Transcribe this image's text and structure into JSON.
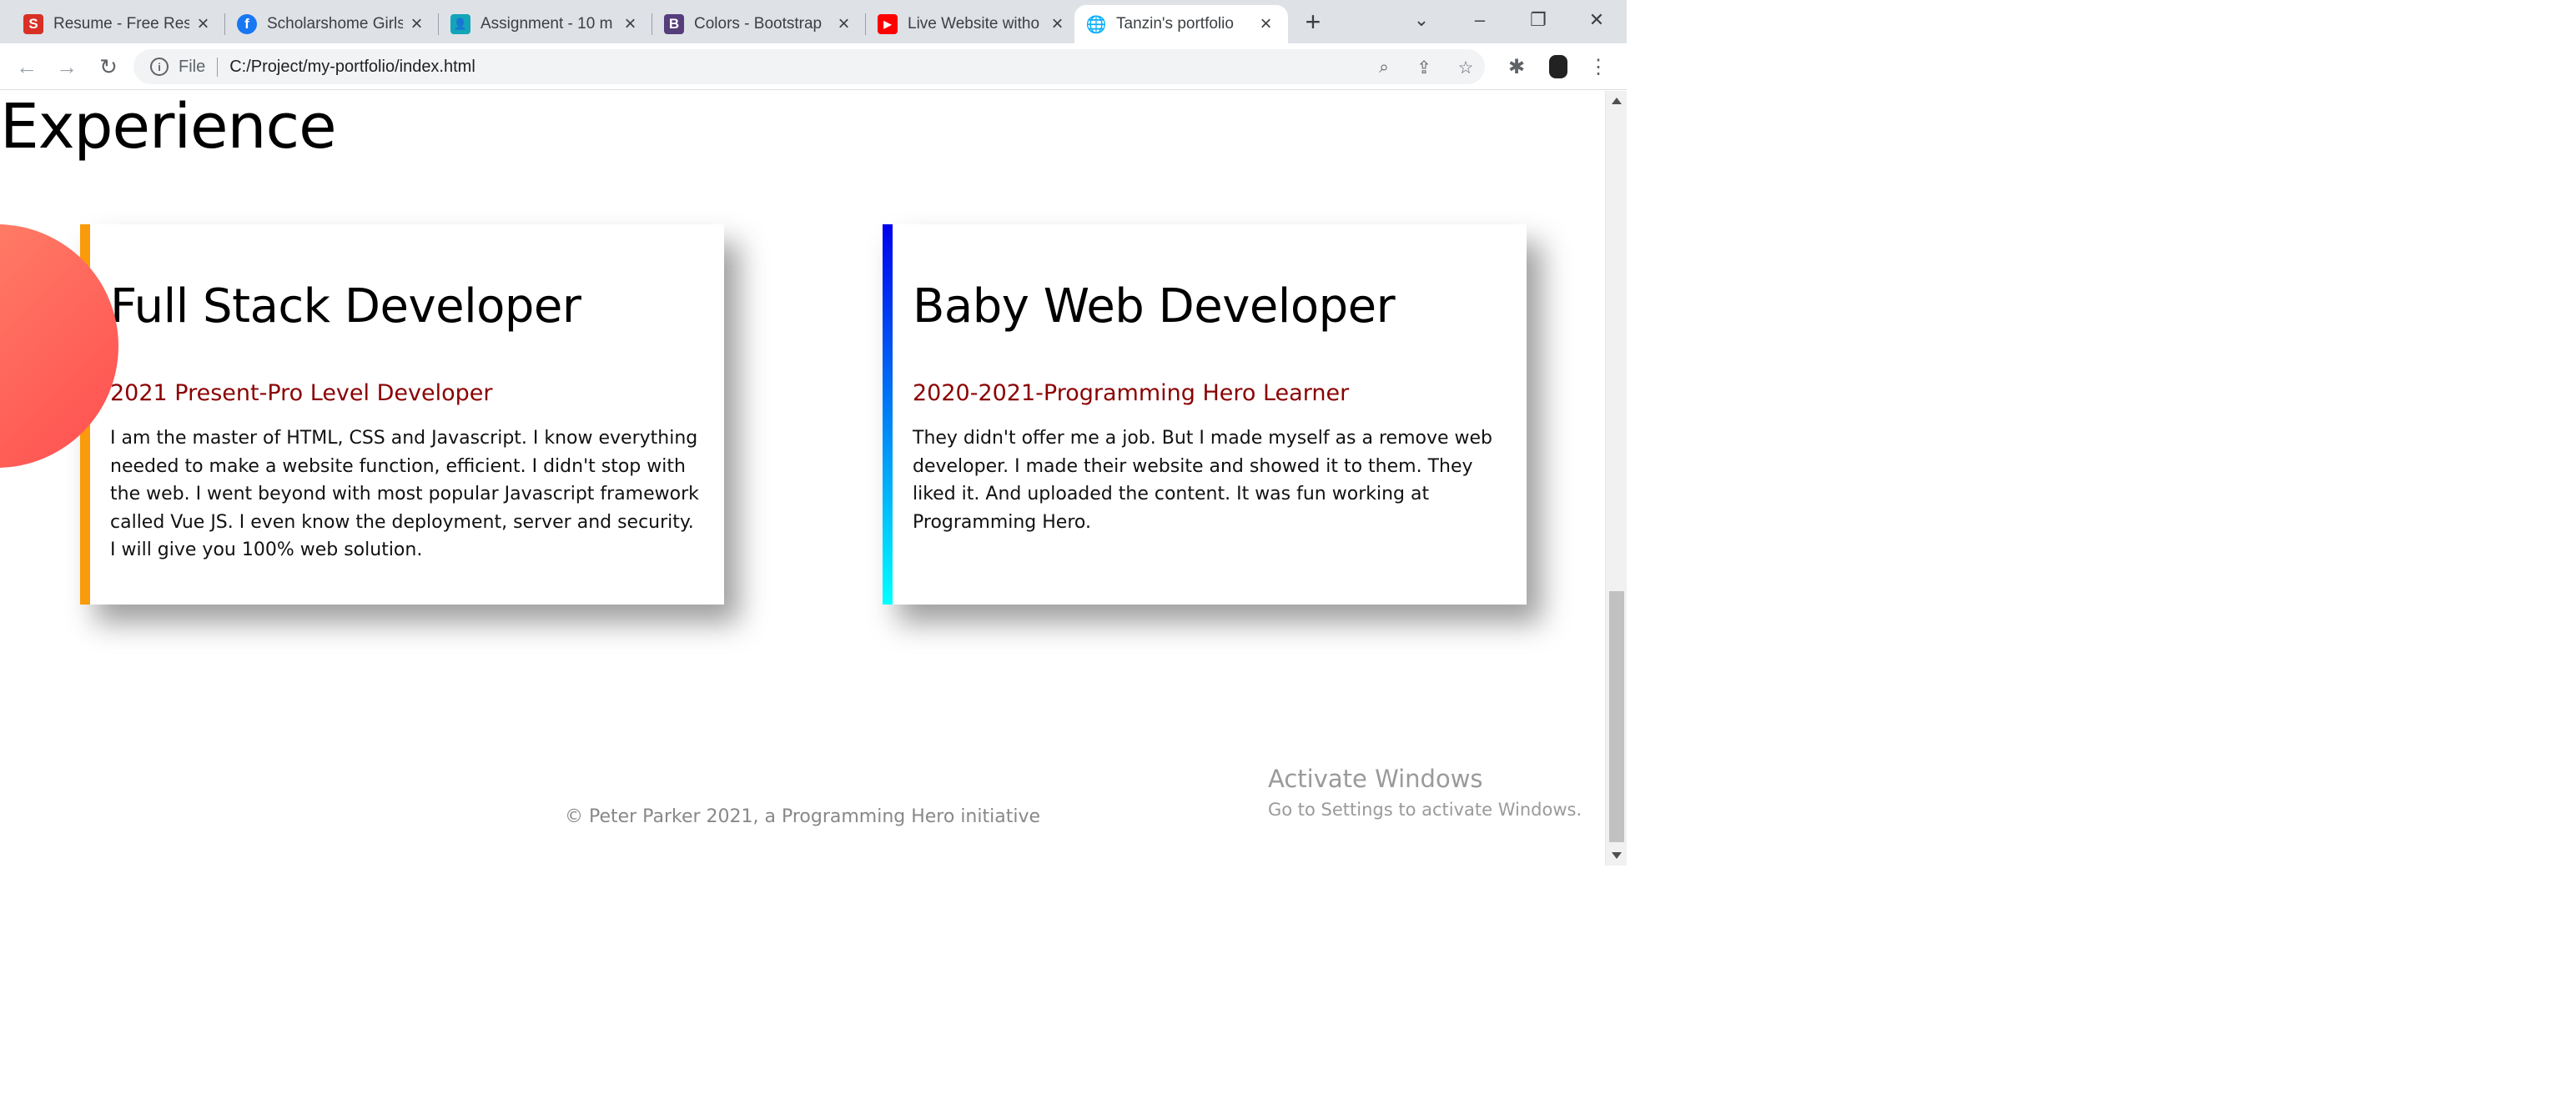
{
  "browser": {
    "tabs": [
      {
        "title": "Resume - Free Resu",
        "favicon": "S",
        "favicon_color": "#d93025",
        "active": false
      },
      {
        "title": "Scholarshome Girls",
        "favicon": "f",
        "favicon_color": "#1877f2",
        "active": false
      },
      {
        "title": "Assignment - 10 m",
        "favicon": "👤",
        "favicon_color": "#12a4b8",
        "active": false
      },
      {
        "title": "Colors - Bootstrap",
        "favicon": "B",
        "favicon_color": "#563d7c",
        "active": false
      },
      {
        "title": "Live Website witho",
        "favicon": "▶",
        "favicon_color": "#ff0000",
        "active": false
      },
      {
        "title": "Tanzin's portfolio",
        "favicon": "🌐",
        "favicon_color": "#5f6368",
        "active": true
      }
    ],
    "address": {
      "scheme_label": "File",
      "url": "C:/Project/my-portfolio/index.html"
    }
  },
  "page": {
    "section_title": "Experience",
    "cards": [
      {
        "title": "Full Stack Developer",
        "subtitle": "2021 Present-Pro Level Developer",
        "description": "I am the master of HTML, CSS and Javascript. I know everything needed to make a website function, efficient. I didn't stop with the web. I went beyond with most popular Javascript framework called Vue JS. I even know the deployment, server and security. I will give you 100% web solution.",
        "accent_color": "#f99b0a"
      },
      {
        "title": "Baby Web Developer",
        "subtitle": "2020-2021-Programming Hero Learner",
        "description": "They didn't offer me a job. But I made myself as a remove web developer. I made their website and showed it to them. They liked it. And uploaded the content. It was fun working at Programming Hero.",
        "accent_color": "#0000ee"
      }
    ],
    "footer": "© Peter Parker 2021, a Programming Hero initiative"
  },
  "os_overlay": {
    "activate_title": "Activate Windows",
    "activate_subtitle": "Go to Settings to activate Windows."
  },
  "colors": {
    "subtitle": "#8b0000",
    "decor_circle": "#ff6b5b"
  }
}
